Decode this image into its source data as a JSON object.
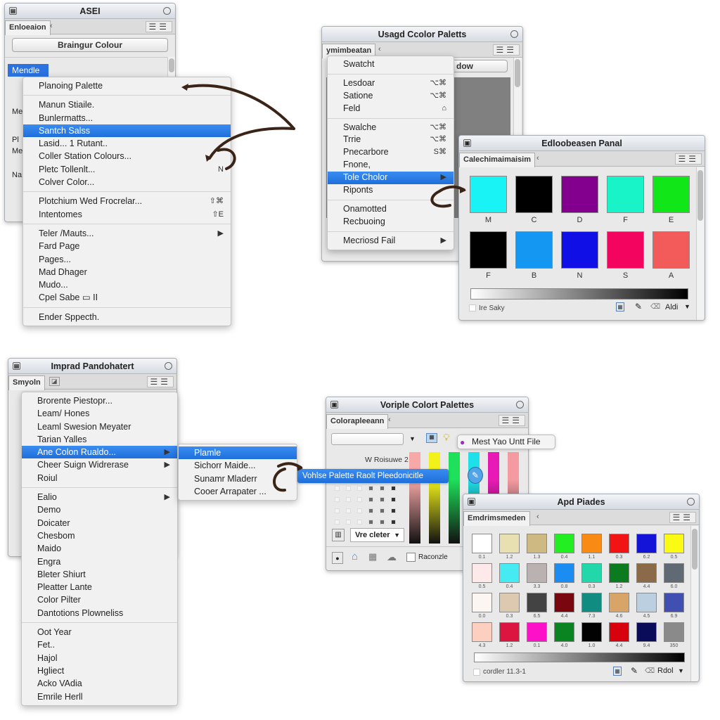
{
  "panel1": {
    "title": "ASEI",
    "tab": "Enloeaion",
    "tab2_icon": "back-icon",
    "button": "Braingur Colour",
    "selected_item": "Mendle",
    "side_labels": [
      "Pl",
      "Me",
      "Na",
      "Me"
    ]
  },
  "menu1": {
    "items": [
      {
        "label": "Planoing Palette",
        "shortcut": ""
      },
      {
        "label": "Manun Stiaile.",
        "shortcut": ""
      },
      {
        "label": "Bunlermatts...",
        "shortcut": ""
      },
      {
        "label": "Santch Salss",
        "shortcut": "",
        "highlighted": true
      },
      {
        "label": "Lasid... 1 Rutant..",
        "shortcut": ""
      },
      {
        "label": "Coller Station Colours...",
        "shortcut": ""
      },
      {
        "label": "Pletc Tollenlt...",
        "shortcut": "N"
      },
      {
        "label": "Colver Color...",
        "shortcut": ""
      },
      {
        "label": "Plotchium Wed Frocrelar...",
        "shortcut": "⇧⌘"
      },
      {
        "label": "Intentomes",
        "shortcut": "⇧E"
      },
      {
        "label": "Teler /Mauts...",
        "shortcut": "▶"
      },
      {
        "label": "Fard Page",
        "shortcut": ""
      },
      {
        "label": "Pages...",
        "shortcut": ""
      },
      {
        "label": "Mad Dhager",
        "shortcut": ""
      },
      {
        "label": "Mudo...",
        "shortcut": ""
      },
      {
        "label": "Cpel Sabe ▭ II",
        "shortcut": ""
      },
      {
        "label": "Ender Sppecth.",
        "shortcut": ""
      }
    ]
  },
  "panel2": {
    "title": "Usagd Ccolor Paletts",
    "tab": "ymimbeatan",
    "button": "dow"
  },
  "menu2": {
    "items": [
      {
        "label": "Swatcht",
        "shortcut": ""
      },
      {
        "label": "Lesdoar",
        "shortcut": "⌥⌘"
      },
      {
        "label": "Satione",
        "shortcut": "⌥⌘"
      },
      {
        "label": "Feld",
        "shortcut": "⌂"
      },
      {
        "label": "Swalche",
        "shortcut": "⌥⌘"
      },
      {
        "label": "Trrie",
        "shortcut": "⌥⌘"
      },
      {
        "label": "Pnecarbore",
        "shortcut": "S⌘"
      },
      {
        "label": "Fnone,",
        "shortcut": ""
      },
      {
        "label": "Tole Cholor",
        "shortcut": "▶",
        "highlighted": true
      },
      {
        "label": "Riponts",
        "shortcut": ""
      },
      {
        "label": "Onamotted",
        "shortcut": ""
      },
      {
        "label": "Recbuoing",
        "shortcut": ""
      },
      {
        "label": "Mecriosd Fail",
        "shortcut": "▶"
      }
    ]
  },
  "panel3": {
    "title": "Edloobeasen Panal",
    "tab": "Calechimaimaisim",
    "swatches": [
      {
        "label": "M",
        "color": "#19f3f6"
      },
      {
        "label": "C",
        "color": "#000000"
      },
      {
        "label": "D",
        "color": "#83008f"
      },
      {
        "label": "F",
        "color": "#19f3c8"
      },
      {
        "label": "E",
        "color": "#11e618"
      },
      {
        "label": "F",
        "color": "#000000"
      },
      {
        "label": "B",
        "color": "#1496f3"
      },
      {
        "label": "N",
        "color": "#1010e6"
      },
      {
        "label": "S",
        "color": "#f3055f"
      },
      {
        "label": "A",
        "color": "#f35a5a"
      }
    ],
    "checkbox_label": "Ire Saky",
    "footer_dropdown": "Aldi"
  },
  "panel4": {
    "title": "Imprad Pandohatert",
    "tab": "Smyoln"
  },
  "menu4": {
    "items": [
      {
        "label": "Brorente Piestopr...",
        "shortcut": ""
      },
      {
        "label": "Leam/ Hones",
        "shortcut": ""
      },
      {
        "label": "Leaml Swesion Meyater",
        "shortcut": ""
      },
      {
        "label": "Tarian Yalles",
        "shortcut": ""
      },
      {
        "label": "Ane Colon Rualdo...",
        "shortcut": "▶",
        "highlighted": true
      },
      {
        "label": "Cheer Suign Widrerase",
        "shortcut": "▶"
      },
      {
        "label": "Roiul",
        "shortcut": ""
      },
      {
        "label": "Ealio",
        "shortcut": "▶"
      },
      {
        "label": "Demo",
        "shortcut": ""
      },
      {
        "label": "Doicater",
        "shortcut": ""
      },
      {
        "label": "Chesbom",
        "shortcut": ""
      },
      {
        "label": "Maido",
        "shortcut": ""
      },
      {
        "label": "Engra",
        "shortcut": ""
      },
      {
        "label": "Bleter Shiurt",
        "shortcut": ""
      },
      {
        "label": "Pleatter Lante",
        "shortcut": ""
      },
      {
        "label": "Color Pilter",
        "shortcut": ""
      },
      {
        "label": "Dantotions Plowneliss",
        "shortcut": ""
      },
      {
        "label": "Oot Year",
        "shortcut": ""
      },
      {
        "label": "Fet..",
        "shortcut": ""
      },
      {
        "label": "Hajol",
        "shortcut": ""
      },
      {
        "label": "Hgliect",
        "shortcut": ""
      },
      {
        "label": "Acko VAdia",
        "shortcut": ""
      },
      {
        "label": "Emrile Herll",
        "shortcut": ""
      }
    ]
  },
  "submenu4": {
    "items": [
      {
        "label": "Plamle",
        "highlighted": true
      },
      {
        "label": "Sichorr Maide..."
      },
      {
        "label": "Sunamr Mladerr"
      },
      {
        "label": "Cooer Arrapater ..."
      }
    ]
  },
  "panel5": {
    "title": "Voriple Colort Palettes",
    "tab": "Colorapleeann",
    "tooltip": "Mest Yao Untt File",
    "row_label": "W Roisuwe 2",
    "highlight_bar": "Vohlse Palette Raolt Pleedonicitle",
    "dropdown": "Vre cleter",
    "checkbox_label": "Raconzle",
    "bars": [
      "#f7a8a8",
      "#f2f21a",
      "#1ee05a",
      "#1ee0e8",
      "#e81ab5",
      "#f59aa0"
    ]
  },
  "panel6": {
    "title": "Apd Piades",
    "tab": "Emdrimsmeden",
    "swatches": [
      {
        "label": "0.1",
        "color": "#ffffff"
      },
      {
        "label": "1.2",
        "color": "#e8e0b0"
      },
      {
        "label": "1.3",
        "color": "#cfb982"
      },
      {
        "label": "0.4",
        "color": "#22ee22"
      },
      {
        "label": "1.1",
        "color": "#f98a14"
      },
      {
        "label": "0.3",
        "color": "#f21414"
      },
      {
        "label": "6.2",
        "color": "#1414d8"
      },
      {
        "label": "0.5",
        "color": "#fafa14"
      },
      {
        "label": "0.5",
        "color": "#fde8ea"
      },
      {
        "label": "0.4",
        "color": "#45eaf2"
      },
      {
        "label": "3.3",
        "color": "#bab2b0"
      },
      {
        "label": "0.8",
        "color": "#1a8cf2"
      },
      {
        "label": "0.3",
        "color": "#22d8aa"
      },
      {
        "label": "1.2",
        "color": "#0c7a1e"
      },
      {
        "label": "4.4",
        "color": "#8a6a48"
      },
      {
        "label": "6.0",
        "color": "#5f6a74"
      },
      {
        "label": "0.0",
        "color": "#fcf6f2"
      },
      {
        "label": "0.3",
        "color": "#dcc9b0"
      },
      {
        "label": "6.5",
        "color": "#434343"
      },
      {
        "label": "4.4",
        "color": "#7a0610"
      },
      {
        "label": "7.3",
        "color": "#108c80"
      },
      {
        "label": "4.6",
        "color": "#d8a468"
      },
      {
        "label": "4.5",
        "color": "#bccfe0"
      },
      {
        "label": "6.9",
        "color": "#3f4fb2"
      },
      {
        "label": "4.3",
        "color": "#fdcfc0"
      },
      {
        "label": "1.2",
        "color": "#dc1440"
      },
      {
        "label": "0.1",
        "color": "#fc10c8"
      },
      {
        "label": "4.0",
        "color": "#0a8420"
      },
      {
        "label": "1.0",
        "color": "#020202"
      },
      {
        "label": "4.4",
        "color": "#d8020e"
      },
      {
        "label": "9.4",
        "color": "#0a0c5a"
      },
      {
        "label": "350",
        "color": "#8a8a8a"
      }
    ],
    "checkbox_label": "cordler 11.3-1",
    "footer_dropdown": "Rdol"
  }
}
